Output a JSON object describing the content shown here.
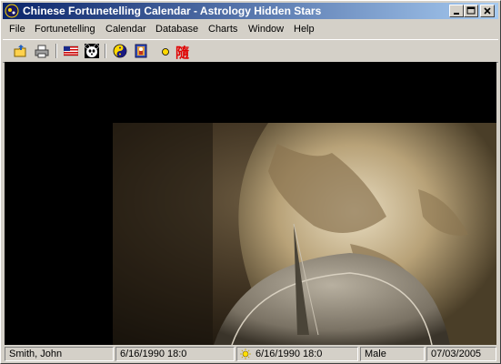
{
  "window": {
    "title": "Chinese Fortunetelling Calendar - Astrology Hidden Stars"
  },
  "menu": [
    "File",
    "Fortunetelling",
    "Calendar",
    "Database",
    "Charts",
    "Window",
    "Help"
  ],
  "toolbar": {
    "sui_char": "隨"
  },
  "status": {
    "name": "Smith, John",
    "birth_datetime": "6/16/1990   18:0",
    "solar_datetime": "6/16/1990   18:0",
    "gender": "Male",
    "date": "07/03/2005"
  },
  "colors": {
    "title_start": "#0a246a",
    "title_end": "#a6caf0",
    "client_bg": "#000000"
  }
}
